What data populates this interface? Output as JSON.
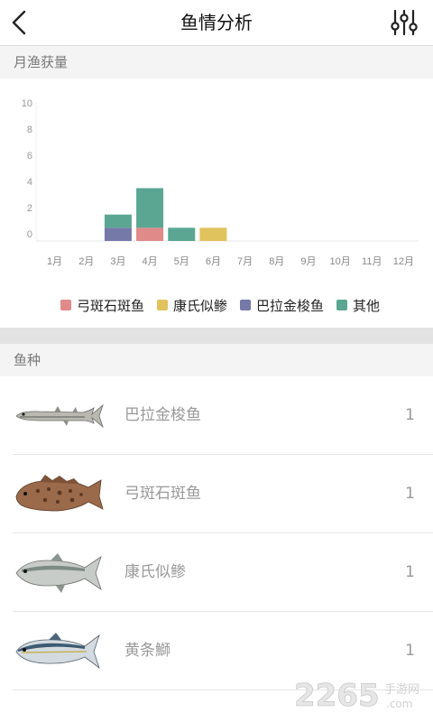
{
  "nav": {
    "title": "鱼情分析",
    "back_icon": "back-chevron-icon",
    "filter_icon": "sliders-icon"
  },
  "monthly": {
    "header": "月渔获量"
  },
  "chart_data": {
    "type": "bar",
    "stacked": true,
    "categories": [
      "1月",
      "2月",
      "3月",
      "4月",
      "5月",
      "6月",
      "7月",
      "8月",
      "9月",
      "10月",
      "11月",
      "12月"
    ],
    "ylim": [
      0,
      10
    ],
    "yticks": [
      0,
      2,
      4,
      6,
      8,
      10
    ],
    "series": [
      {
        "name": "弓斑石斑鱼",
        "color": "#e08a8a",
        "values": [
          0,
          0,
          0,
          1,
          0,
          0,
          0,
          0,
          0,
          0,
          0,
          0
        ]
      },
      {
        "name": "康氏似鲹",
        "color": "#e0c35c",
        "values": [
          0,
          0,
          0,
          0,
          0,
          1,
          0,
          0,
          0,
          0,
          0,
          0
        ]
      },
      {
        "name": "巴拉金梭鱼",
        "color": "#7479a8",
        "values": [
          0,
          0,
          1,
          0,
          0,
          0,
          0,
          0,
          0,
          0,
          0,
          0
        ]
      },
      {
        "name": "其他",
        "color": "#5aa692",
        "values": [
          0,
          0,
          1,
          3,
          1,
          0,
          0,
          0,
          0,
          0,
          0,
          0
        ]
      }
    ],
    "xlabel": "",
    "ylabel": "",
    "legend": "bottom"
  },
  "species": {
    "header": "鱼种",
    "items": [
      {
        "name": "巴拉金梭鱼",
        "count": "1",
        "icon": "barracuda-image"
      },
      {
        "name": "弓斑石斑鱼",
        "count": "1",
        "icon": "grouper-image"
      },
      {
        "name": "康氏似鲹",
        "count": "1",
        "icon": "queenfish-image"
      },
      {
        "name": "黄条鰤",
        "count": "1",
        "icon": "yellowtail-image"
      }
    ]
  },
  "watermark": {
    "number": "2265",
    "cn": "手游网",
    "url": ".com"
  }
}
